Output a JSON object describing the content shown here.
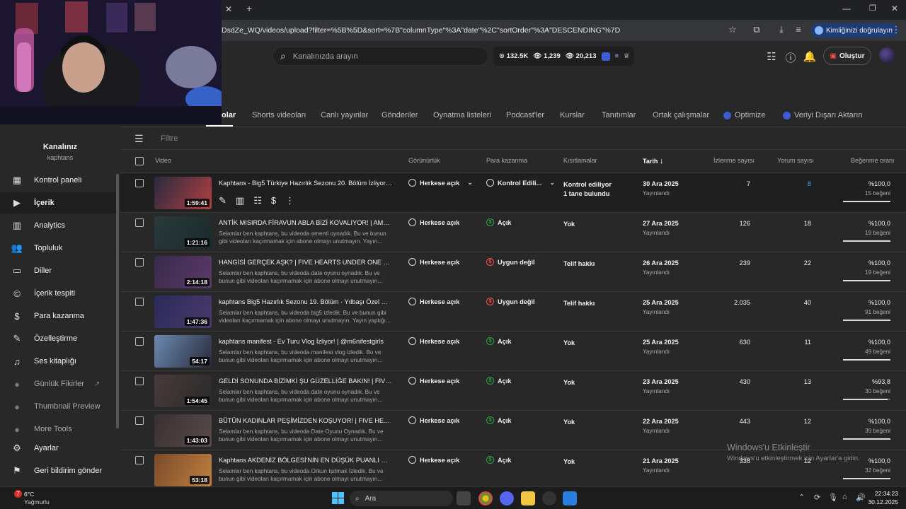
{
  "browser": {
    "url": "DsdZe_WQ/videos/upload?filter=%5B%5D&sort=%7B\"columnType\"%3A\"date\"%2C\"sortOrder\"%3A\"DESCENDING\"%7D",
    "verify_label": "Kimliğinizi doğrulayın"
  },
  "header": {
    "search_placeholder": "Kanalınızda arayın",
    "stats": {
      "subs": "132.5K",
      "views_a": "1,239",
      "views_b": "20,213"
    },
    "create_label": "Oluştur"
  },
  "channel": {
    "name": "Kanalınız",
    "handle": "kaphtans"
  },
  "sidebar": {
    "items": [
      {
        "label": "Kontrol paneli",
        "icon": "dashboard-icon"
      },
      {
        "label": "İçerik",
        "icon": "content-icon"
      },
      {
        "label": "Analytics",
        "icon": "analytics-icon"
      },
      {
        "label": "Topluluk",
        "icon": "community-icon"
      },
      {
        "label": "Diller",
        "icon": "subtitles-icon"
      },
      {
        "label": "İçerik tespiti",
        "icon": "copyright-icon"
      },
      {
        "label": "Para kazanma",
        "icon": "earn-icon"
      },
      {
        "label": "Özelleştirme",
        "icon": "customization-icon"
      },
      {
        "label": "Ses kitaplığı",
        "icon": "audio-library-icon"
      },
      {
        "label": "Günlük Fikirler",
        "icon": "extension-icon"
      },
      {
        "label": "Thumbnail Preview",
        "icon": "extension-icon"
      },
      {
        "label": "More Tools",
        "icon": "extension-icon"
      },
      {
        "label": "Ayarlar",
        "icon": "settings-icon"
      },
      {
        "label": "Geri bildirim gönder",
        "icon": "feedback-icon"
      }
    ]
  },
  "tabs": [
    "olar",
    "Shorts videoları",
    "Canlı yayınlar",
    "Gönderiler",
    "Oynatma listeleri",
    "Podcast'ler",
    "Kurslar",
    "Tanıtımlar",
    "Ortak çalışmalar",
    "Optimize",
    "Veriyi Dışarı Aktarın"
  ],
  "filter_placeholder": "Filtre",
  "columns": {
    "video": "Video",
    "visibility": "Görünürlük",
    "monetization": "Para kazanma",
    "restrictions": "Kısıtlamalar",
    "date": "Tarih",
    "views": "İzlenme sayısı",
    "comments": "Yorum sayısı",
    "likes": "Beğenme oranı"
  },
  "videos": [
    {
      "title": "Kaphtans - Big5 Türkiye Hazırlık Sezonu 20. Bölüm İzliyor! | Yı...",
      "desc": "",
      "duration": "1:59:41",
      "visibility": "Herkese açık",
      "monetization": "Kontrol Edili...",
      "restriction": "Kontrol ediliyor",
      "restriction2": "1 tane bulundu",
      "date": "30 Ara 2025",
      "status": "Yayınlandı",
      "views": "7",
      "comments": "8",
      "like_pct": "%100,0",
      "likes": "15 beğeni",
      "like_ratio": 1.0,
      "mon_state": "checking"
    },
    {
      "title": "ANTİK MISIRDA FİRAVUN ABLA BİZİ KOVALIYOR! | AMENTI",
      "desc": "Selamlar ben kaphtans, bu videoda amenti oynadık. Bu ve bunun gibi videoları kaçırmamak için abone olmayı unutmayın. Yayın...",
      "duration": "1:21:16",
      "visibility": "Herkese açık",
      "monetization": "Açık",
      "restriction": "Yok",
      "restriction2": "",
      "date": "27 Ara 2025",
      "status": "Yayınlandı",
      "views": "126",
      "comments": "18",
      "like_pct": "%100,0",
      "likes": "19 beğeni",
      "like_ratio": 1.0,
      "mon_state": "on"
    },
    {
      "title": "HANGİSİ GERÇEK AŞK? | FIVE HEARTS UNDER ONE ROOF Fİ...",
      "desc": "Selamlar ben kaphtans, bu videoda date oyunu oynadık. Bu ve bunun gibi videoları kaçırmamak için abone olmayı unutmayın...",
      "duration": "2:14:18",
      "visibility": "Herkese açık",
      "monetization": "Uygun değil",
      "restriction": "Telif hakkı",
      "restriction2": "",
      "date": "26 Ara 2025",
      "status": "Yayınlandı",
      "views": "239",
      "comments": "22",
      "like_pct": "%100,0",
      "likes": "19 beğeni",
      "like_ratio": 1.0,
      "mon_state": "off"
    },
    {
      "title": "kaphtans Big5 Hazırlık Sezonu 19. Bölüm · Yılbaşı Özel Hazırl...",
      "desc": "Selamlar ben kaphtans, bu videoda big5 izledik. Bu ve bunun gibi videoları kaçırmamak için abone olmayı unutmayın. Yayın yaptığı...",
      "duration": "1:47:36",
      "visibility": "Herkese açık",
      "monetization": "Uygun değil",
      "restriction": "Telif hakkı",
      "restriction2": "",
      "date": "25 Ara 2025",
      "status": "Yayınlandı",
      "views": "2.035",
      "comments": "40",
      "like_pct": "%100,0",
      "likes": "91 beğeni",
      "like_ratio": 1.0,
      "mon_state": "off"
    },
    {
      "title": "kaphtans manifest - Ev Turu Vlog İzliyor! | @m6nifestgirls",
      "desc": "Selamlar ben kaphtans, bu videoda manifest vlog izledik. Bu ve bunun gibi videoları kaçırmamak için abone olmayı unutmayın...",
      "duration": "54:17",
      "visibility": "Herkese açık",
      "monetization": "Açık",
      "restriction": "Yok",
      "restriction2": "",
      "date": "25 Ara 2025",
      "status": "Yayınlandı",
      "views": "630",
      "comments": "11",
      "like_pct": "%100,0",
      "likes": "49 beğeni",
      "like_ratio": 1.0,
      "mon_state": "on"
    },
    {
      "title": "GELDİ SONUNDA BİZİMKİ ŞU GÜZELLİĞE BAKIN! | FIVE HEAR...",
      "desc": "Selamlar ben kaphtans, bu videoda date oyunu oynadık. Bu ve bunun gibi videoları kaçırmamak için abone olmayı unutmayın...",
      "duration": "1:54:45",
      "visibility": "Herkese açık",
      "monetization": "Açık",
      "restriction": "Yok",
      "restriction2": "",
      "date": "23 Ara 2025",
      "status": "Yayınlandı",
      "views": "430",
      "comments": "13",
      "like_pct": "%93,8",
      "likes": "30 beğeni",
      "like_ratio": 0.938,
      "mon_state": "on"
    },
    {
      "title": "BÜTÜN KADINLAR PEŞİMİZDEN KOŞUYOR! | FIVE HEARTS U...",
      "desc": "Selamlar ben kaphtans, bu videoda Date Oyunu Oynadık. Bu ve bunun gibi videoları kaçırmamak için abone olmayı unutmayın...",
      "duration": "1:43:03",
      "visibility": "Herkese açık",
      "monetization": "Açık",
      "restriction": "Yok",
      "restriction2": "",
      "date": "22 Ara 2025",
      "status": "Yayınlandı",
      "views": "443",
      "comments": "12",
      "like_pct": "%100,0",
      "likes": "39 beğeni",
      "like_ratio": 1.0,
      "mon_state": "on"
    },
    {
      "title": "Kaphtans AKDENİZ BÖLGESİ'NİN EN DÜŞÜK PUANLI RESTO...",
      "desc": "Selamlar ben kaphtans, bu videoda Orkun Işıtmak İzledik. Bu ve bunun gibi videoları kaçırmamak için abone olmayı unutmayın...",
      "duration": "53:18",
      "visibility": "Herkese açık",
      "monetization": "Açık",
      "restriction": "Yok",
      "restriction2": "",
      "date": "21 Ara 2025",
      "status": "Yayınlandı",
      "views": "338",
      "comments": "12",
      "like_pct": "%100,0",
      "likes": "32 beğeni",
      "like_ratio": 1.0,
      "mon_state": "on"
    }
  ],
  "windows": {
    "activation_title": "Windows'u Etkinleştir",
    "activation_sub": "Windows'u etkinleştirmek için Ayarlar'a gidin."
  },
  "taskbar": {
    "weather_temp": "6°C",
    "weather_text": "Yağmurlu",
    "weather_badge": "7",
    "search": "Ara",
    "time": "22:34:23",
    "date": "30.12.2025"
  }
}
